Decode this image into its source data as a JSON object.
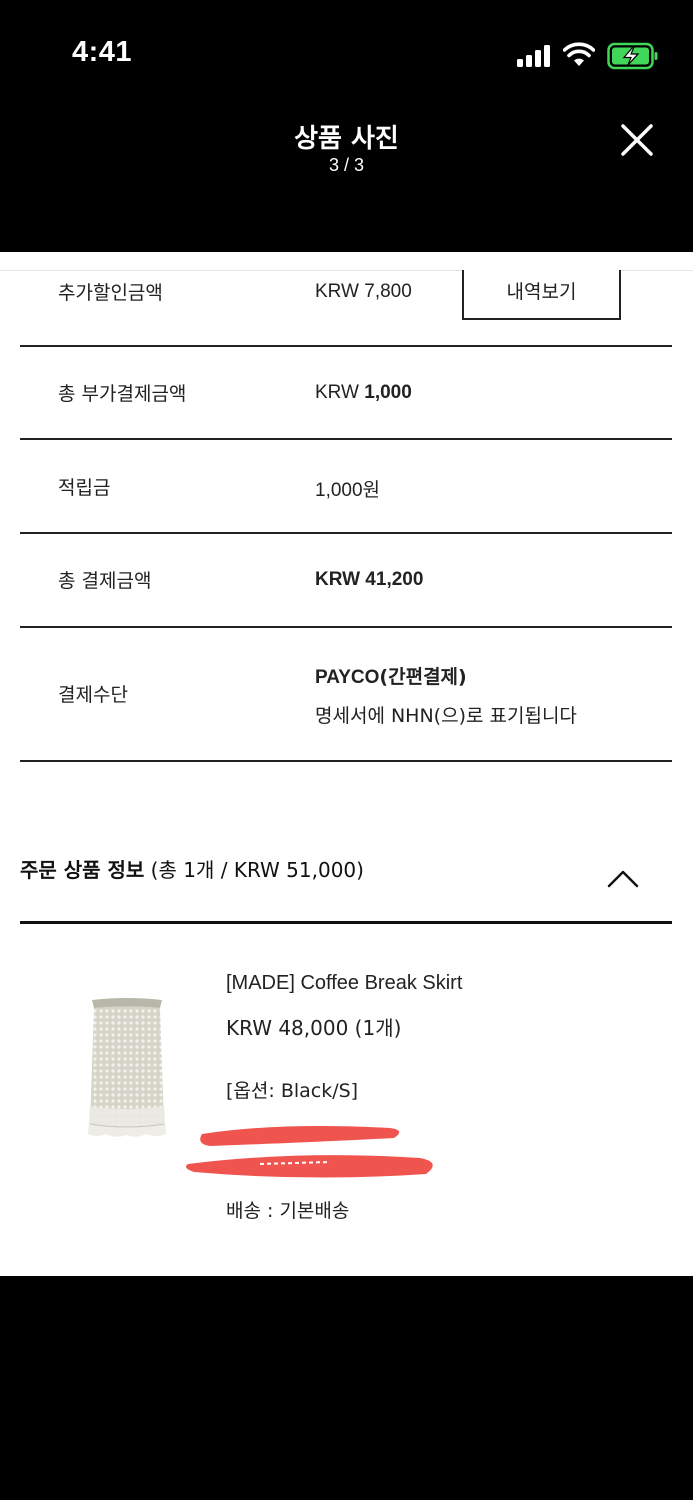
{
  "status_bar": {
    "time": "4:41"
  },
  "header": {
    "title": "상품 사진",
    "counter": "3 / 3"
  },
  "payment_summary": {
    "extra_discount": {
      "label": "추가할인금액",
      "value": "KRW 7,800",
      "button": "내역보기"
    },
    "total_additional": {
      "label": "총 부가결제금액",
      "currency": "KRW",
      "amount": "1,000"
    },
    "points": {
      "label": "적립금",
      "value": "1,000원"
    },
    "total_payment": {
      "label": "총 결제금액",
      "value": "KRW 41,200"
    },
    "method": {
      "label": "결제수단",
      "name_latin": "PAYCO",
      "name_korean": "(간편결제)",
      "note": "명세서에 NHN(으)로 표기됩니다"
    }
  },
  "order_info": {
    "title": "주문 상품 정보",
    "summary": " (총 1개 / KRW 51,000)"
  },
  "product": {
    "name": "[MADE] Coffee Break Skirt",
    "price": "KRW 48,000 (1개)",
    "option": "[옵션: Black/S]",
    "shipping": "배송 : 기본배송"
  },
  "colors": {
    "redaction": "#f0544f",
    "header_bg": "#000000"
  }
}
